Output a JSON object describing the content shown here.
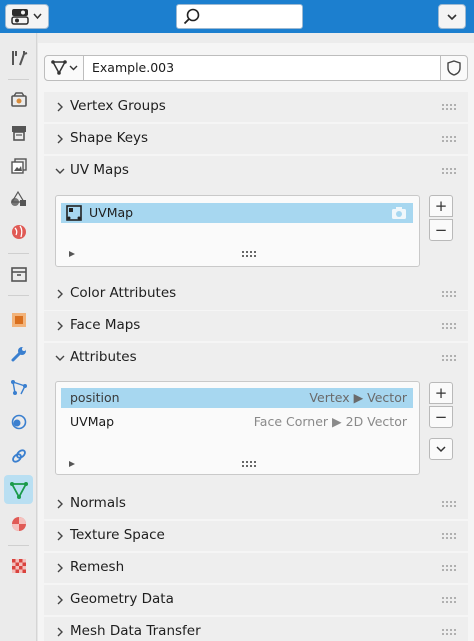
{
  "header": {
    "editor_type_icon": "properties-editor-icon",
    "search": {
      "value": "",
      "icon": "search-icon"
    },
    "menu_icon": "chevron-down-icon"
  },
  "colors": {
    "header_blue": "#1c7fcf",
    "selection_blue": "#a7d7f0",
    "active_tab": "#b9dff2",
    "panel_bg": "#eeeeee"
  },
  "sidebar": {
    "tabs": [
      {
        "name": "tool",
        "icon": "tool-icon",
        "active": false
      },
      {
        "name": "render",
        "icon": "render-icon",
        "active": false
      },
      {
        "name": "output",
        "icon": "output-icon",
        "active": false
      },
      {
        "name": "view-layer",
        "icon": "view-layer-icon",
        "active": false
      },
      {
        "name": "scene",
        "icon": "scene-icon",
        "active": false
      },
      {
        "name": "world",
        "icon": "world-icon",
        "active": false
      },
      {
        "name": "collection",
        "icon": "collection-icon",
        "active": false
      },
      {
        "name": "object",
        "icon": "object-icon",
        "active": false
      },
      {
        "name": "modifiers",
        "icon": "wrench-icon",
        "active": false
      },
      {
        "name": "particles",
        "icon": "particles-icon",
        "active": false
      },
      {
        "name": "physics",
        "icon": "physics-icon",
        "active": false
      },
      {
        "name": "constraints",
        "icon": "constraints-icon",
        "active": false
      },
      {
        "name": "data",
        "icon": "mesh-data-icon",
        "active": true
      },
      {
        "name": "material",
        "icon": "material-icon",
        "active": false
      },
      {
        "name": "texture",
        "icon": "texture-icon",
        "active": false
      }
    ]
  },
  "mesh": {
    "name": "Example.003",
    "type_icon": "mesh-data-icon",
    "fake_user_icon": "shield-icon"
  },
  "panels": {
    "vertex_groups": {
      "title": "Vertex Groups",
      "expanded": false
    },
    "shape_keys": {
      "title": "Shape Keys",
      "expanded": false
    },
    "uv_maps": {
      "title": "UV Maps",
      "expanded": true,
      "items": [
        {
          "name": "UVMap",
          "icon": "uv-map-icon",
          "active_render_icon": "camera-icon",
          "selected": true
        }
      ],
      "add_label": "+",
      "remove_label": "−"
    },
    "color_attributes": {
      "title": "Color Attributes",
      "expanded": false
    },
    "face_maps": {
      "title": "Face Maps",
      "expanded": false
    },
    "attributes": {
      "title": "Attributes",
      "expanded": true,
      "rows": [
        {
          "name": "position",
          "domain": "Vertex ▶ Vector",
          "selected": true
        },
        {
          "name": "UVMap",
          "domain": "Face Corner ▶ 2D Vector",
          "selected": false
        }
      ],
      "add_label": "+",
      "remove_label": "−",
      "specials_icon": "chevron-down-icon"
    },
    "normals": {
      "title": "Normals",
      "expanded": false
    },
    "texture_space": {
      "title": "Texture Space",
      "expanded": false
    },
    "remesh": {
      "title": "Remesh",
      "expanded": false
    },
    "geometry_data": {
      "title": "Geometry Data",
      "expanded": false
    },
    "mesh_data_transfer": {
      "title": "Mesh Data Transfer",
      "expanded": false
    }
  }
}
